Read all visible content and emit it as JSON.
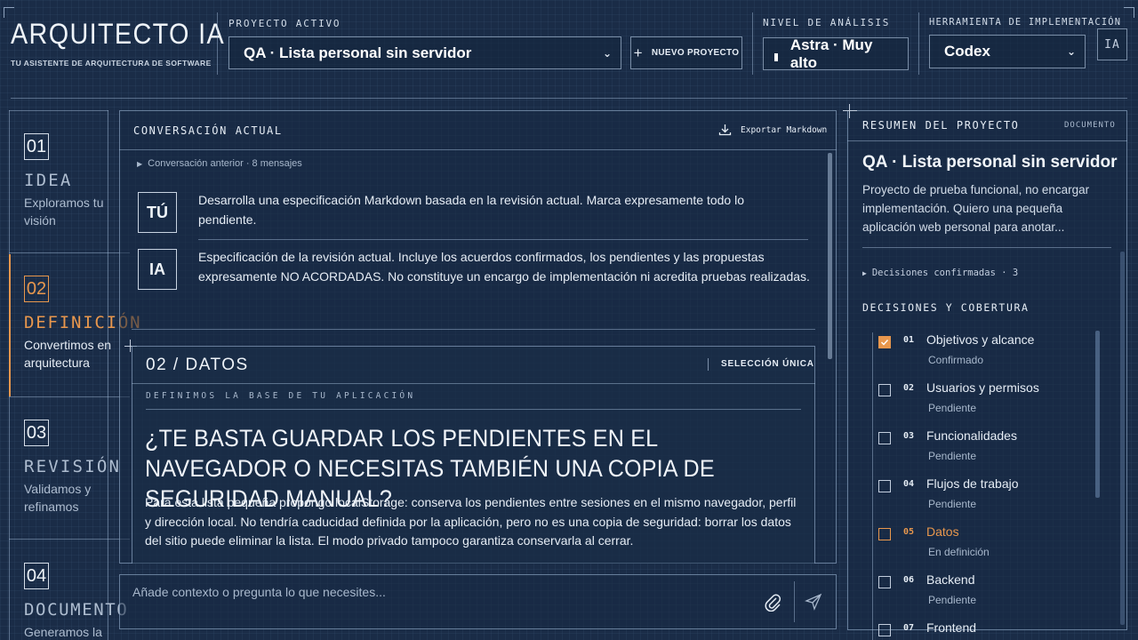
{
  "brand": {
    "title": "ARQUITECTO IA",
    "subtitle": "TU ASISTENTE DE ARQUITECTURA DE SOFTWARE"
  },
  "header": {
    "project_label": "PROYECTO ACTIVO",
    "project_value": "QA · Lista personal sin servidor",
    "new_project": "NUEVO PROYECTO",
    "level_label": "NIVEL DE ANÁLISIS",
    "level_value": "Astra · Muy alto",
    "tool_label": "HERRAMIENTA DE IMPLEMENTACIÓN",
    "tool_value": "Codex",
    "avatar": "IA"
  },
  "steps": [
    {
      "num": "01",
      "title": "IDEA",
      "desc": "Exploramos tu visión"
    },
    {
      "num": "02",
      "title": "DEFINICIÓN",
      "desc": "Convertimos en arquitectura"
    },
    {
      "num": "03",
      "title": "REVISIÓN",
      "desc": "Validamos y refinamos"
    },
    {
      "num": "04",
      "title": "DOCUMENTO",
      "desc": "Generamos la"
    }
  ],
  "conversation": {
    "title": "CONVERSACIÓN ACTUAL",
    "export": "Exportar Markdown",
    "previous": "Conversación anterior · 8 mensajes",
    "messages": [
      {
        "tag": "TÚ",
        "text": "Desarrolla una especificación Markdown basada en la revisión actual. Marca expresamente todo lo pendiente."
      },
      {
        "tag": "IA",
        "text": "Especificación de la revisión actual. Incluye los acuerdos confirmados, los pendientes y las propuestas expresamente NO ACORDADAS. No constituye un encargo de implementación ni acredita pruebas realizadas."
      }
    ],
    "card": {
      "heading": "02 / DATOS",
      "mode": "SELECCIÓN ÚNICA",
      "kicker": "DEFINIMOS LA BASE DE TU APLICACIÓN",
      "question": "¿TE BASTA GUARDAR LOS PENDIENTES EN EL NAVEGADOR O NECESITAS TAMBIÉN UNA COPIA DE SEGURIDAD MANUAL?",
      "body": "Para esta lista pequeña propongo localStorage: conserva los pendientes entre sesiones en el mismo navegador, perfil y dirección local. No tendría caducidad definida por la aplicación, pero no es una copia de seguridad: borrar los datos del sitio puede eliminar la lista. El modo privado tampoco garantiza conservarla al cerrar."
    },
    "input_placeholder": "Añade contexto o pregunta lo que necesites..."
  },
  "summary": {
    "title": "RESUMEN DEL PROYECTO",
    "doc_link": "DOCUMENTO",
    "project_name": "QA · Lista personal sin servidor",
    "project_desc": "Proyecto de prueba funcional, no encargar implementación. Quiero una pequeña aplicación web personal para anotar...",
    "confirmed_toggle": "Decisiones confirmadas · 3",
    "coverage_title": "DECISIONES Y COBERTURA",
    "items": [
      {
        "num": "01",
        "label": "Objetivos y alcance",
        "status": "Confirmado",
        "state": "done"
      },
      {
        "num": "02",
        "label": "Usuarios y permisos",
        "status": "Pendiente",
        "state": "pending"
      },
      {
        "num": "03",
        "label": "Funcionalidades",
        "status": "Pendiente",
        "state": "pending"
      },
      {
        "num": "04",
        "label": "Flujos de trabajo",
        "status": "Pendiente",
        "state": "pending"
      },
      {
        "num": "05",
        "label": "Datos",
        "status": "En definición",
        "state": "doing"
      },
      {
        "num": "06",
        "label": "Backend",
        "status": "Pendiente",
        "state": "pending"
      },
      {
        "num": "07",
        "label": "Frontend",
        "status": "",
        "state": "pending"
      }
    ]
  },
  "colors": {
    "background": "#1a2c47",
    "accent": "#e8974d",
    "text": "#e6edf5"
  }
}
